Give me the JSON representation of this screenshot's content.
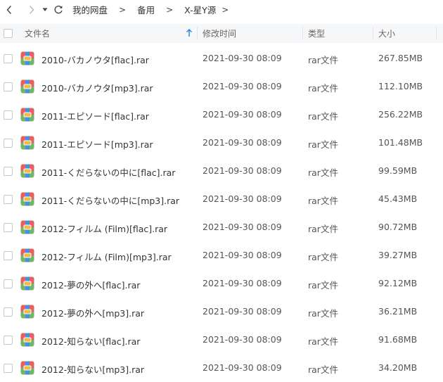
{
  "nav": {
    "back_icon": "chevron-left-icon",
    "forward_icon": "chevron-right-icon",
    "dropdown_icon": "caret-down-icon",
    "refresh_icon": "refresh-icon"
  },
  "breadcrumb": {
    "items": [
      "我的网盘",
      "备用",
      "X-星Y源"
    ],
    "separator": ">"
  },
  "columns": {
    "name": "文件名",
    "mtime": "修改时间",
    "type": "类型",
    "size": "大小",
    "sort_icon": "arrow-up-icon"
  },
  "colors": {
    "accent": "#2b8ae6",
    "header_bg": "#f6f7f9",
    "archive_icon_top": "#e95f5f",
    "archive_icon_bottom": "#6fb86a",
    "archive_icon_clasp": "#f2b84b"
  },
  "files": [
    {
      "name": "2010-バカノウタ[flac].rar",
      "mtime": "2021-09-30 08:09",
      "type": "rar文件",
      "size": "267.85MB",
      "icon": "archive-icon"
    },
    {
      "name": "2010-バカノウタ[mp3].rar",
      "mtime": "2021-09-30 08:09",
      "type": "rar文件",
      "size": "112.10MB",
      "icon": "archive-icon"
    },
    {
      "name": "2011-エピソード[flac].rar",
      "mtime": "2021-09-30 08:09",
      "type": "rar文件",
      "size": "256.22MB",
      "icon": "archive-icon"
    },
    {
      "name": "2011-エピソード[mp3].rar",
      "mtime": "2021-09-30 08:09",
      "type": "rar文件",
      "size": "101.48MB",
      "icon": "archive-icon"
    },
    {
      "name": "2011-くだらないの中に[flac].rar",
      "mtime": "2021-09-30 08:09",
      "type": "rar文件",
      "size": "99.59MB",
      "icon": "archive-icon"
    },
    {
      "name": "2011-くだらないの中に[mp3].rar",
      "mtime": "2021-09-30 08:09",
      "type": "rar文件",
      "size": "45.43MB",
      "icon": "archive-icon"
    },
    {
      "name": "2012-フィルム (Film)[flac].rar",
      "mtime": "2021-09-30 08:09",
      "type": "rar文件",
      "size": "90.72MB",
      "icon": "archive-icon"
    },
    {
      "name": "2012-フィルム (Film)[mp3].rar",
      "mtime": "2021-09-30 08:09",
      "type": "rar文件",
      "size": "39.27MB",
      "icon": "archive-icon"
    },
    {
      "name": "2012-夢の外へ[flac].rar",
      "mtime": "2021-09-30 08:09",
      "type": "rar文件",
      "size": "92.12MB",
      "icon": "archive-icon"
    },
    {
      "name": "2012-夢の外へ[mp3].rar",
      "mtime": "2021-09-30 08:09",
      "type": "rar文件",
      "size": "36.21MB",
      "icon": "archive-icon"
    },
    {
      "name": "2012-知らない[flac].rar",
      "mtime": "2021-09-30 08:09",
      "type": "rar文件",
      "size": "91.68MB",
      "icon": "archive-icon"
    },
    {
      "name": "2012-知らない[mp3].rar",
      "mtime": "2021-09-30 08:09",
      "type": "rar文件",
      "size": "34.20MB",
      "icon": "archive-icon"
    }
  ]
}
